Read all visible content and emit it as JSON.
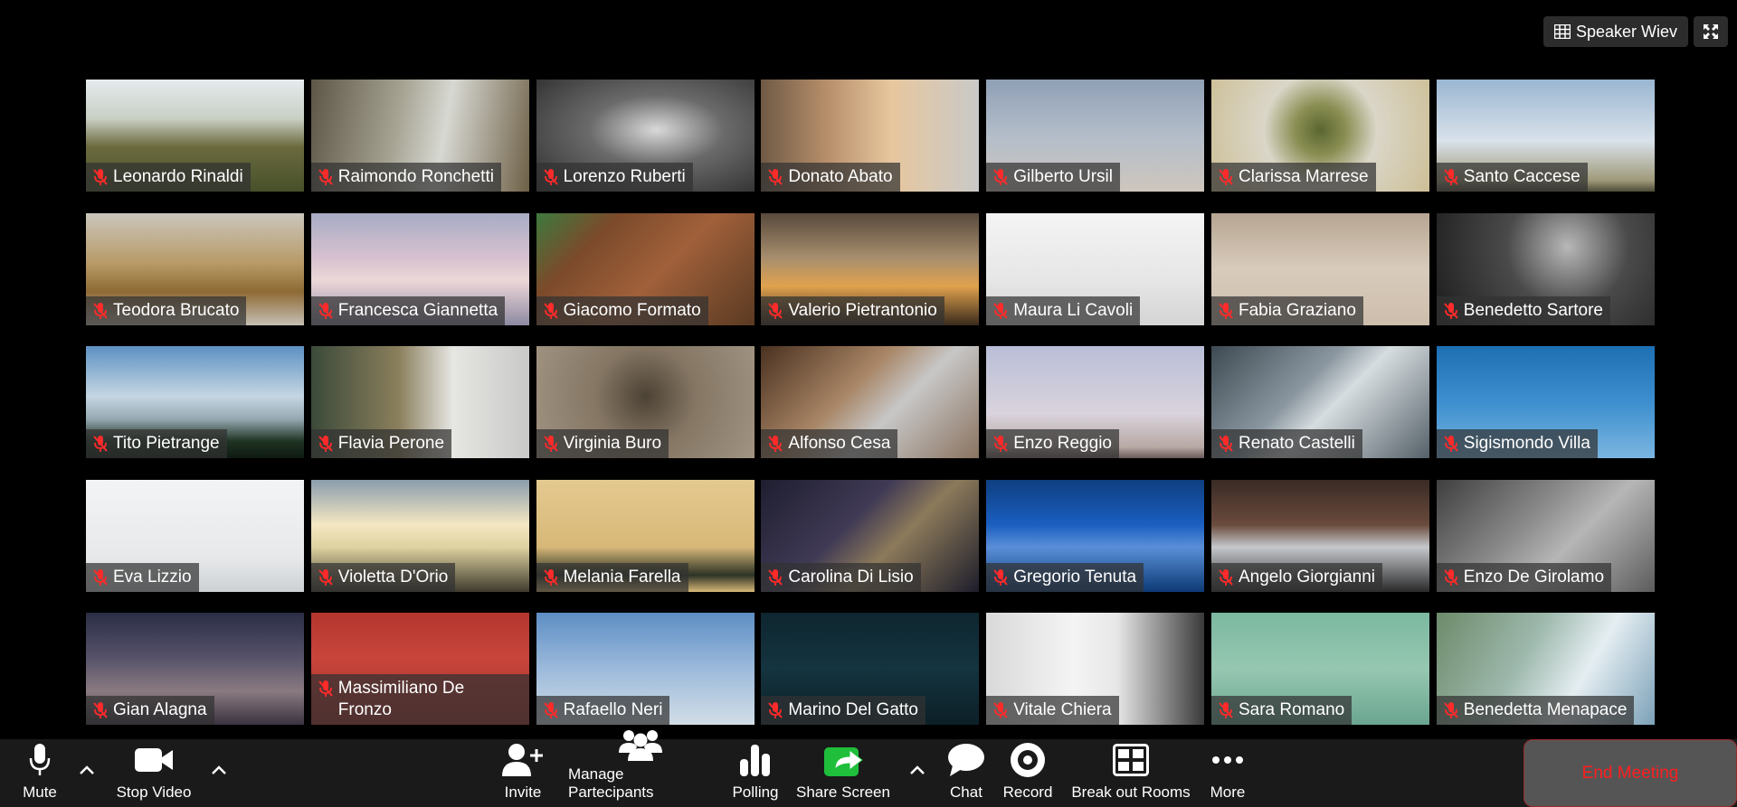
{
  "view_controls": {
    "speaker_view_label": "Speaker Wiev"
  },
  "participants": [
    {
      "name": "Leonardo Rinaldi",
      "bg": "linear-gradient(180deg,#e6ebee 0%,#c8cfc4 35%,#6b6a3e 60%,#46502a 100%)"
    },
    {
      "name": "Raimondo Ronchetti",
      "bg": "linear-gradient(100deg,#5d5646 0%,#a8a595 40%,#d7d8d2 60%,#6e6047 100%)"
    },
    {
      "name": "Lorenzo Ruberti",
      "bg": "radial-gradient(ellipse at 55% 45%,#d9d9d9 0%,#6a6a6a 40%,#2c2c2c 100%)"
    },
    {
      "name": "Donato Abato",
      "bg": "linear-gradient(90deg,#6f5a46 0%,#b68e6a 30%,#e7c79e 60%,#c9c9c8 100%)"
    },
    {
      "name": "Gilberto Ursil",
      "bg": "linear-gradient(180deg,#8fa0b6 0%,#b3bdc9 50%,#cfc6bd 100%)"
    },
    {
      "name": "Clarissa Marrese",
      "bg": "radial-gradient(circle at 50% 45%,#5a6631 0%,#8a8e52 20%,#dad6c8 45%,#cdbf96 100%)"
    },
    {
      "name": "Santo Caccese",
      "bg": "linear-gradient(180deg,#9ab6d2 0%,#d9e2ea 55%,#a09a7a 90%,#4b4a36 100%)"
    },
    {
      "name": "Teodora Brucato",
      "bg": "linear-gradient(180deg,#cbc6bd 0%,#b79a66 45%,#8e6a34 70%,#c6bfb4 100%)"
    },
    {
      "name": "Francesca Giannetta",
      "bg": "linear-gradient(180deg,#a7acc4 0%,#d7c1cf 40%,#ecd7d8 60%,#8e8aa2 100%)"
    },
    {
      "name": "Giacomo Formato",
      "bg": "linear-gradient(135deg,#3d7a3e 0%,#7b4a2b 25%,#a0603a 55%,#5a3a22 100%)"
    },
    {
      "name": "Valerio Pietrantonio",
      "bg": "linear-gradient(180deg,#584a3c 0%,#a88e6e 40%,#e0a24e 65%,#3a2a1c 100%)"
    },
    {
      "name": "Maura Li Cavoli",
      "bg": "linear-gradient(180deg,#f4f4f4 0%,#e6e6e6 60%,#d4d4d4 100%)"
    },
    {
      "name": "Fabia Graziano",
      "bg": "linear-gradient(180deg,#b7a592 0%,#d8cbbb 50%,#cdbdac 100%)"
    },
    {
      "name": "Benedetto Sartore",
      "bg": "radial-gradient(circle at 60% 30%,#b8b8b8 0%,#4a4a4a 40%,#1c1c1c 100%)"
    },
    {
      "name": "Tito Pietrange",
      "bg": "linear-gradient(180deg,#5d91c4 0%,#c5d6e2 45%,#96a9b2 65%,#1f3322 85%,#0f1a12 100%)"
    },
    {
      "name": "Flavia Perone",
      "bg": "linear-gradient(90deg,#3b4a3a 0%,#8a7f5c 40%,#e6e6e3 65%,#c9c9c7 100%)"
    },
    {
      "name": "Virginia Buro",
      "bg": "radial-gradient(circle at 50% 45%,#4c4234 0%,#857664 40%,#a19482 100%)"
    },
    {
      "name": "Alfonso Cesa",
      "bg": "linear-gradient(135deg,#4a3120 0%,#a88565 40%,#c7c7c7 60%,#8a7360 100%)"
    },
    {
      "name": "Enzo Reggio",
      "bg": "linear-gradient(180deg,#b9bed8 0%,#d9d3dc 60%,#b8a9a4 90%,#6a5a5a 100%)"
    },
    {
      "name": "Renato Castelli",
      "bg": "linear-gradient(135deg,#3d4a52 0%,#8b97a0 40%,#d6dde0 55%,#556068 100%)"
    },
    {
      "name": "Sigismondo Villa",
      "bg": "linear-gradient(180deg,#1d6fb3 0%,#3d8fcf 50%,#7ab5e0 100%)"
    },
    {
      "name": "Eva Lizzio",
      "bg": "linear-gradient(180deg,#f3f4f5 0%,#e6e8ea 70%,#cdd1d4 100%)"
    },
    {
      "name": "Violetta D'Orio",
      "bg": "linear-gradient(180deg,#8a9dad 0%,#f5e7c2 40%,#ded2a0 60%,#3f3b2e 100%)"
    },
    {
      "name": "Melania Farella",
      "bg": "linear-gradient(180deg,#e4c98f 0%,#d7b878 60%,#2d3325 85%,#d7b878 100%)"
    },
    {
      "name": "Carolina Di Lisio",
      "bg": "linear-gradient(135deg,#1e1e30 0%,#403a55 40%,#8c7a5a 60%,#1d1d2b 100%)"
    },
    {
      "name": "Gregorio Tenuta",
      "bg": "linear-gradient(180deg,#0e3f80 0%,#1a5ec0 40%,#5a8fd8 60%,#0d3a75 100%)"
    },
    {
      "name": "Angelo Giorgianni",
      "bg": "linear-gradient(180deg,#3a2b25 0%,#6a4a3c 40%,#c5c8cc 60%,#2a2a2a 100%)"
    },
    {
      "name": "Enzo De Girolamo",
      "bg": "linear-gradient(135deg,#3f3f3f 0%,#8a8a8a 40%,#b6b6b6 60%,#5c5c5c 100%)"
    },
    {
      "name": "Gian Alagna",
      "bg": "linear-gradient(180deg,#2a2e45 0%,#56526a 40%,#8a7a80 70%,#3a3240 100%)"
    },
    {
      "name": "Massimiliano De Fronzo",
      "bg": "linear-gradient(180deg,#b3352d 0%,#c8453b 40%,#a02e2a 100%)"
    },
    {
      "name": "Rafaello Neri",
      "bg": "linear-gradient(180deg,#5d8ec4 0%,#9cbadb 50%,#d2dde6 100%)"
    },
    {
      "name": "Marino Del Gatto",
      "bg": "linear-gradient(180deg,#0e2630 0%,#14343f 50%,#0c1f27 100%)"
    },
    {
      "name": "Vitale Chiera",
      "bg": "linear-gradient(90deg,#d9d9d9 0%,#f4f4f4 40%,#e7e7e7 60%,#3a3a3a 100%)"
    },
    {
      "name": "Sara Romano",
      "bg": "linear-gradient(180deg,#7bb8a0 0%,#96c7b1 50%,#6aa590 100%)"
    },
    {
      "name": "Benedetta Menapace",
      "bg": "linear-gradient(120deg,#6d8a6a 0%,#9eb9ad 40%,#e5eef2 65%,#7ca1b8 100%)"
    }
  ],
  "toolbar": {
    "mute_label": "Mute",
    "stop_video_label": "Stop Video",
    "invite_label": "Invite",
    "manage_participants_label": "Manage Partecipants",
    "polling_label": "Polling",
    "share_screen_label": "Share Screen",
    "chat_label": "Chat",
    "record_label": "Record",
    "breakout_rooms_label": "Break out Rooms",
    "more_label": "More",
    "end_meeting_label": "End Meeting"
  },
  "colors": {
    "share_green": "#1fbf3b",
    "end_red": "#ff1f1f",
    "mic_off_red": "#ff2a2a"
  }
}
